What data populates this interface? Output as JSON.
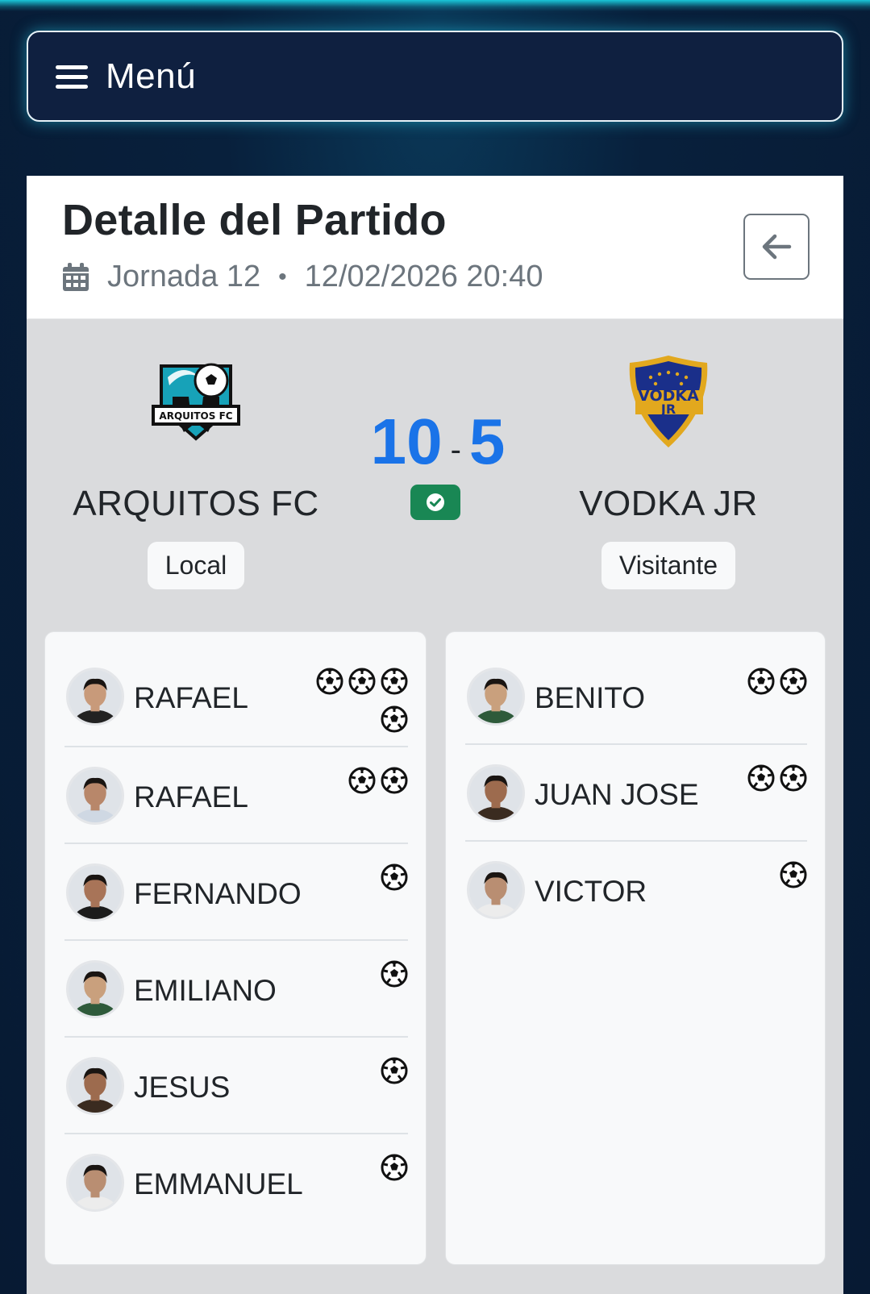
{
  "menu": {
    "label": "Menú",
    "icon": "hamburger-icon"
  },
  "header": {
    "title": "Detalle del Partido",
    "jornada": "Jornada 12",
    "separator": "•",
    "datetime": "12/02/2026 20:40",
    "calendar_icon": "calendar-icon",
    "back_icon": "arrow-left-icon"
  },
  "match": {
    "home": {
      "name": "ARQUITOS FC",
      "badge": "Local",
      "logo_text": "ARQUITOS FC",
      "score": "10"
    },
    "away": {
      "name": "VODKA JR",
      "badge": "Visitante",
      "logo_text_top": "VODKA",
      "logo_text_bottom": "JR",
      "score": "5"
    },
    "score_separator": "-",
    "status_icon": "check-circle-icon",
    "status_color": "#198754",
    "score_color": "#1a73e8"
  },
  "home_scorers": [
    {
      "name": "RAFAEL",
      "goals": 4
    },
    {
      "name": "RAFAEL",
      "goals": 2
    },
    {
      "name": "FERNANDO",
      "goals": 1
    },
    {
      "name": "EMILIANO",
      "goals": 1
    },
    {
      "name": "JESUS",
      "goals": 1
    },
    {
      "name": "EMMANUEL",
      "goals": 1
    }
  ],
  "away_scorers": [
    {
      "name": "BENITO",
      "goals": 2
    },
    {
      "name": "JUAN JOSE",
      "goals": 2
    },
    {
      "name": "VICTOR",
      "goals": 1
    }
  ]
}
